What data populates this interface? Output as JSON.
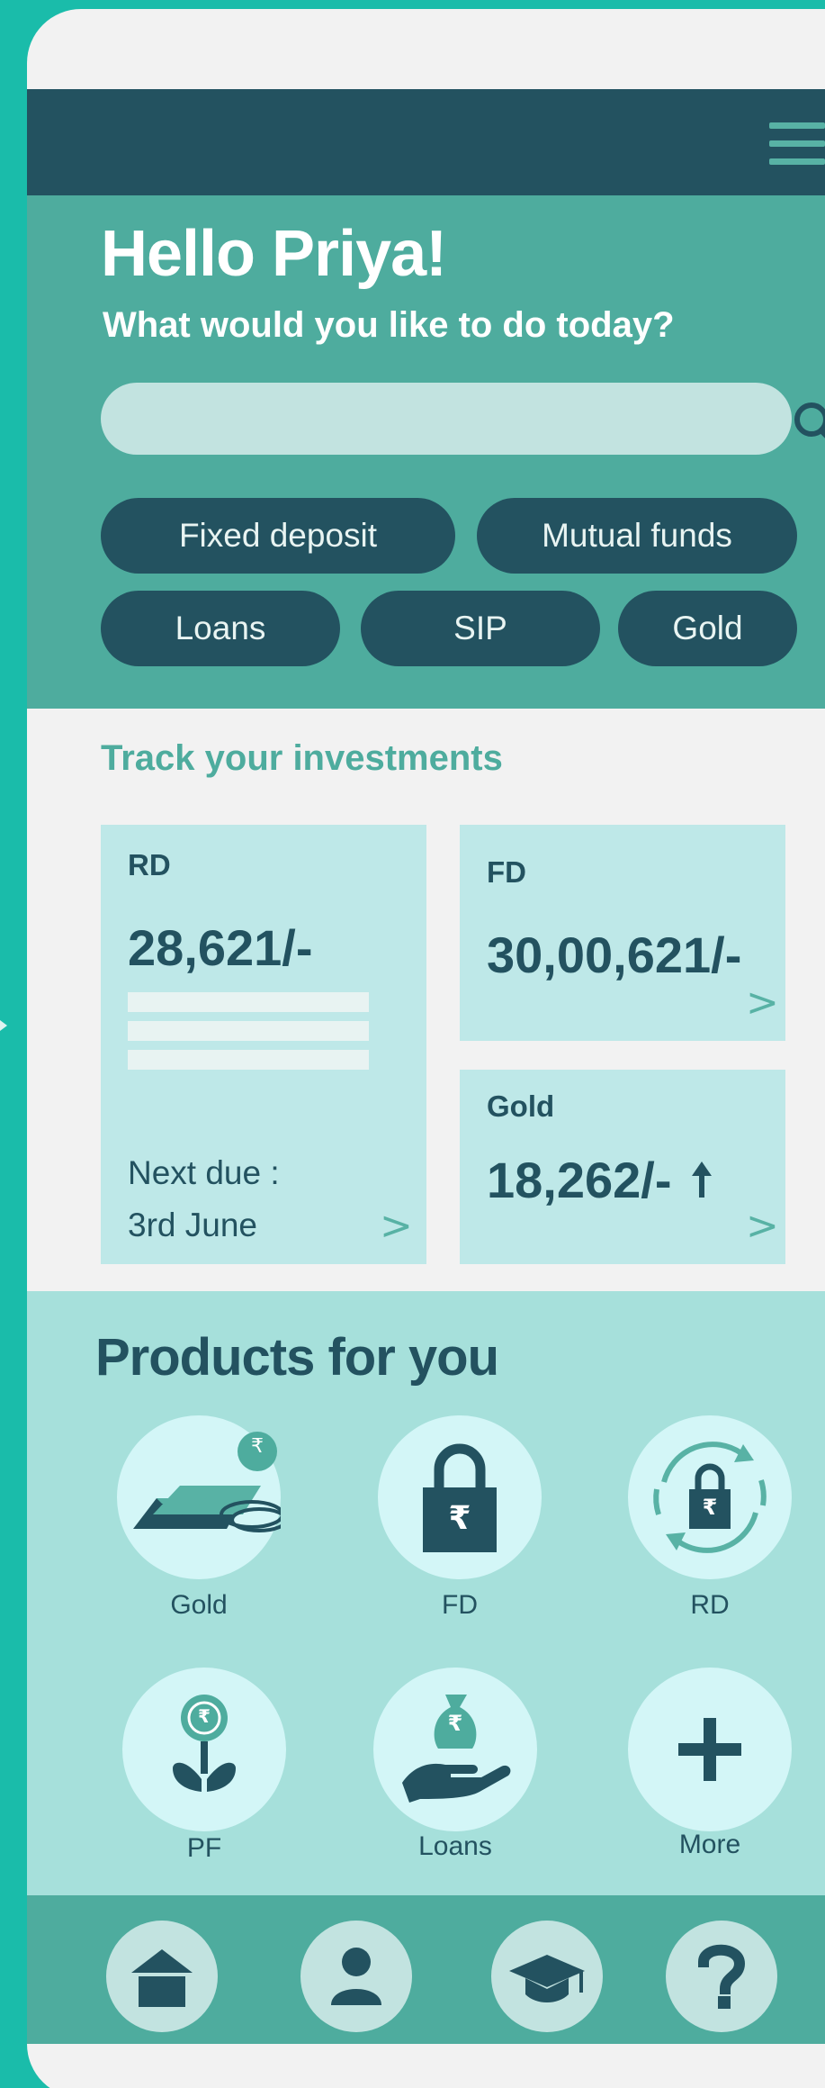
{
  "header": {
    "menu_icon": "menu-icon"
  },
  "hero": {
    "greeting": "Hello Priya!",
    "subtitle": "What would you like to do today?",
    "search": {
      "value": "",
      "placeholder": "",
      "icon": "search-icon"
    },
    "chips": [
      "Fixed deposit",
      "Mutual funds",
      "Loans",
      "SIP",
      "Gold"
    ]
  },
  "investments": {
    "title": "Track your investments",
    "rd": {
      "label": "RD",
      "amount": "28,621/-",
      "due_label": "Next due :",
      "due_date": "3rd June",
      "chevron": ">"
    },
    "fd": {
      "label": "FD",
      "amount": "30,00,621/-",
      "chevron": ">"
    },
    "gold": {
      "label": "Gold",
      "amount": "18,262/-",
      "trend_icon": "arrow-up-icon",
      "chevron": ">"
    }
  },
  "products": {
    "title": "Products for you",
    "items": [
      {
        "label": "Gold",
        "icon": "gold-bars-icon"
      },
      {
        "label": "FD",
        "icon": "padlock-rupee-icon"
      },
      {
        "label": "RD",
        "icon": "recurring-padlock-icon"
      },
      {
        "label": "PF",
        "icon": "rupee-plant-icon"
      },
      {
        "label": "Loans",
        "icon": "hand-money-bag-icon"
      },
      {
        "label": "More",
        "icon": "plus-icon"
      }
    ],
    "rupee_symbol": "₹"
  },
  "bottom_nav": {
    "items": [
      "home-icon",
      "user-icon",
      "graduation-cap-icon",
      "help-icon"
    ]
  },
  "colors": {
    "background": "#1abcaa",
    "dark": "#235260",
    "teal": "#4eac9e",
    "card": "#bee8e8",
    "products_bg": "#a6e0db",
    "icon_circle": "#d3f6f7"
  }
}
